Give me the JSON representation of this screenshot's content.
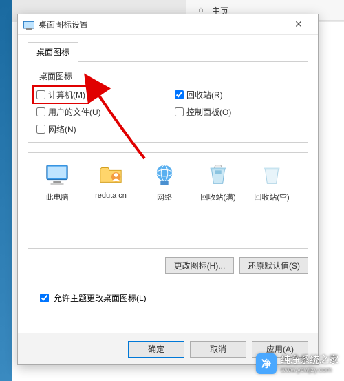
{
  "ribbon": {
    "home_label": "主页"
  },
  "dialog": {
    "title": "桌面图标设置",
    "tab": "桌面图标",
    "group_legend": "桌面图标",
    "checkboxes": {
      "computer": {
        "label": "计算机(M)",
        "checked": false
      },
      "recyclebin": {
        "label": "回收站(R)",
        "checked": true
      },
      "userfiles": {
        "label": "用户的文件(U)",
        "checked": false
      },
      "controlpanel": {
        "label": "控制面板(O)",
        "checked": false
      },
      "network": {
        "label": "网络(N)",
        "checked": false
      }
    },
    "icons": [
      {
        "name": "此电脑",
        "key": "thispc"
      },
      {
        "name": "reduta cn",
        "key": "userfolder"
      },
      {
        "name": "网络",
        "key": "network"
      },
      {
        "name": "回收站(满)",
        "key": "bin-full"
      },
      {
        "name": "回收站(空)",
        "key": "bin-empty"
      }
    ],
    "change_icon_btn": "更改图标(H)...",
    "restore_btn": "还原默认值(S)",
    "theme_checkbox": {
      "label": "允许主题更改桌面图标(L)",
      "checked": true
    },
    "ok_btn": "确定",
    "cancel_btn": "取消",
    "apply_btn": "应用(A)"
  },
  "watermark": {
    "brand": "纯净系统之家",
    "url": "www.ycwjzy.com"
  }
}
